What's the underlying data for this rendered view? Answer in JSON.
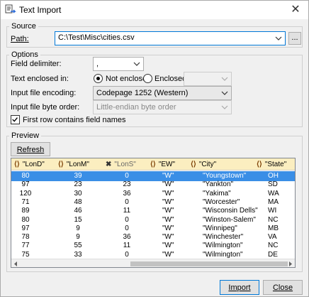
{
  "window": {
    "title": "Text Import"
  },
  "source": {
    "legend": "Source",
    "path_label": "Path:",
    "path_value": "C:\\Test\\Misc\\cities.csv",
    "browse_label": "..."
  },
  "options": {
    "legend": "Options",
    "delimiter_label": "Field delimiter:",
    "delimiter_value": ",",
    "enclosed_label": "Text enclosed in:",
    "not_enclosed_label": "Not enclosed",
    "enclosed_option_label": "Enclosed",
    "encoding_label": "Input file encoding:",
    "encoding_value": "Codepage 1252 (Western)",
    "byte_order_label": "Input file byte order:",
    "byte_order_value": "Little-endian byte order",
    "first_row_label": "First row contains field names",
    "first_row_checked": true
  },
  "preview": {
    "legend": "Preview",
    "refresh_label": "Refresh",
    "columns": [
      "\"LonD\"",
      "\"LonM\"",
      "\"LonS\"",
      "\"EW\"",
      "\"City\"",
      "\"State\""
    ],
    "rows": [
      [
        "80",
        "39",
        "0",
        "\"W\"",
        "\"Youngstown\"",
        "OH"
      ],
      [
        "97",
        "23",
        "23",
        "\"W\"",
        "\"Yankton\"",
        "SD"
      ],
      [
        "120",
        "30",
        "36",
        "\"W\"",
        "\"Yakima\"",
        "WA"
      ],
      [
        "71",
        "48",
        "0",
        "\"W\"",
        "\"Worcester\"",
        "MA"
      ],
      [
        "89",
        "46",
        "11",
        "\"W\"",
        "\"Wisconsin Dells\"",
        "WI"
      ],
      [
        "80",
        "15",
        "0",
        "\"W\"",
        "\"Winston-Salem\"",
        "NC"
      ],
      [
        "97",
        "9",
        "0",
        "\"W\"",
        "\"Winnipeg\"",
        "MB"
      ],
      [
        "78",
        "9",
        "36",
        "\"W\"",
        "\"Winchester\"",
        "VA"
      ],
      [
        "77",
        "55",
        "11",
        "\"W\"",
        "\"Wilmington\"",
        "NC"
      ],
      [
        "75",
        "33",
        "0",
        "\"W\"",
        "\"Wilmington\"",
        "DE"
      ]
    ]
  },
  "footer": {
    "import_label": "Import",
    "close_label": "Close"
  }
}
